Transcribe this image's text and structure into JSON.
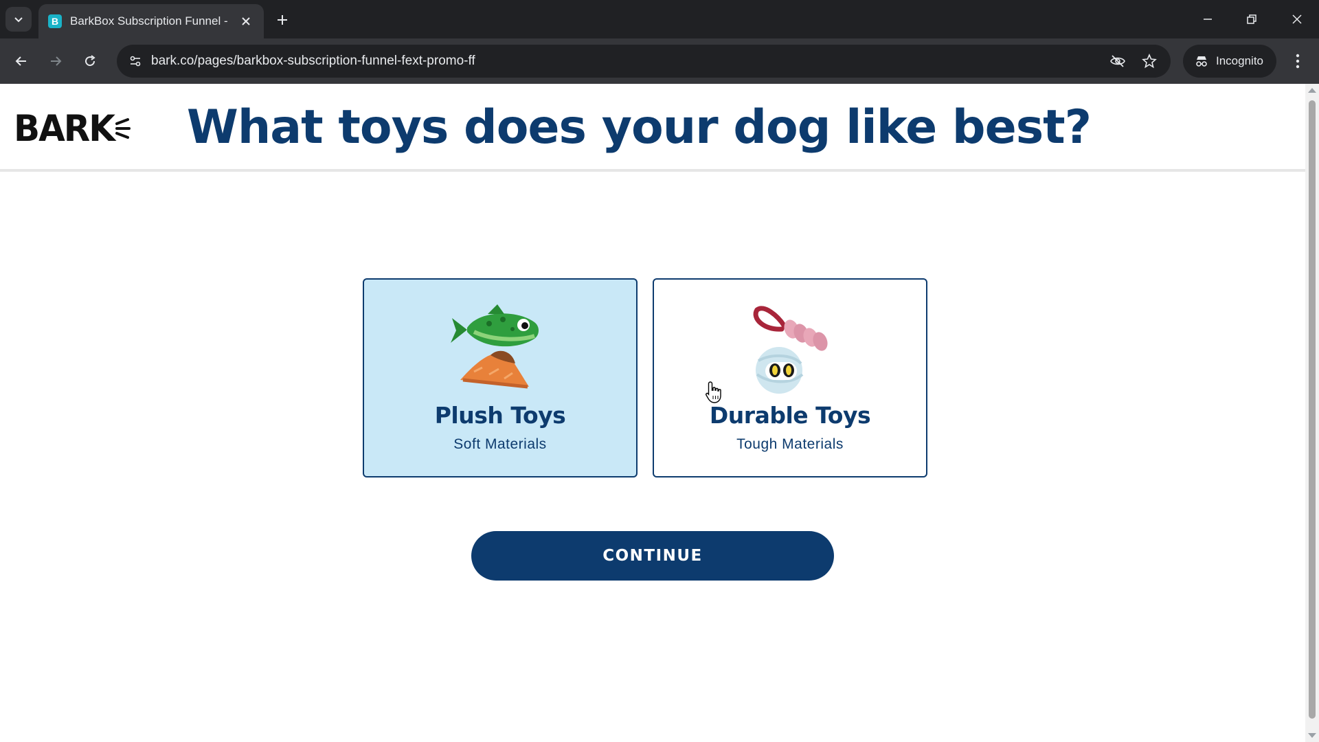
{
  "browser": {
    "tab_title": "BarkBox Subscription Funnel - F",
    "url": "bark.co/pages/barkbox-subscription-funnel-fext-promo-ff",
    "incognito_label": "Incognito"
  },
  "header": {
    "logo_text": "BARK",
    "title": "What toys does your dog like best?"
  },
  "options": [
    {
      "title": "Plush Toys",
      "subtitle": "Soft Materials",
      "selected": true
    },
    {
      "title": "Durable Toys",
      "subtitle": "Tough Materials",
      "selected": false
    }
  ],
  "continue_label": "CONTINUE",
  "colors": {
    "brand_navy": "#0d3b6e",
    "selected_bg": "#c9e8f7",
    "chrome_dark": "#202124",
    "chrome_mid": "#35363a"
  }
}
